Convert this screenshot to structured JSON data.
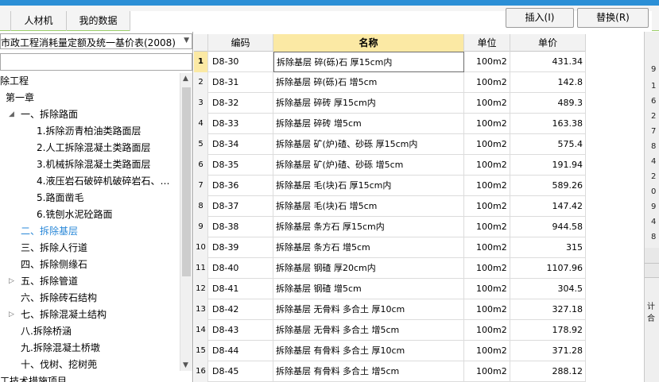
{
  "tabs": [
    {
      "label": "人材机"
    },
    {
      "label": "我的数据"
    }
  ],
  "toolbar": {
    "insert_label": "插入(I)",
    "replace_label": "替换(R)"
  },
  "left_panel": {
    "quota_select": "市政工程消耗量定额及统一基价表(2008)",
    "search_value": "",
    "tree": [
      {
        "label": "除工程"
      },
      {
        "label": "第一章"
      },
      {
        "label": "一、拆除路面"
      },
      {
        "label": "1.拆除沥青柏油类路面层"
      },
      {
        "label": "2.人工拆除混凝土类路面层"
      },
      {
        "label": "3.机械拆除混凝土类路面层"
      },
      {
        "label": "4.液压岩石破碎机破碎岩石、…"
      },
      {
        "label": "5.路面凿毛"
      },
      {
        "label": "6.铣刨水泥砼路面"
      },
      {
        "label": "二、拆除基层"
      },
      {
        "label": "三、拆除人行道"
      },
      {
        "label": "四、拆除侧缘石"
      },
      {
        "label": "五、拆除管道"
      },
      {
        "label": "六、拆除砖石结构"
      },
      {
        "label": "七、拆除混凝土结构"
      },
      {
        "label": "八.拆除桥涵"
      },
      {
        "label": "九.拆除混凝土桥墩"
      },
      {
        "label": "十、伐树、挖树蔸"
      },
      {
        "label": "工技术措施项目"
      }
    ]
  },
  "grid": {
    "columns": {
      "code": "编码",
      "name": "名称",
      "unit": "单位",
      "price": "单价"
    },
    "rows": [
      {
        "idx": "1",
        "code": "D8-30",
        "name": "拆除基层 碎(砾)石 厚15cm内",
        "unit": "100m2",
        "price": "431.34"
      },
      {
        "idx": "2",
        "code": "D8-31",
        "name": "拆除基层 碎(砾)石 增5cm",
        "unit": "100m2",
        "price": "142.8"
      },
      {
        "idx": "3",
        "code": "D8-32",
        "name": "拆除基层 碎砖 厚15cm内",
        "unit": "100m2",
        "price": "489.3"
      },
      {
        "idx": "4",
        "code": "D8-33",
        "name": "拆除基层 碎砖 增5cm",
        "unit": "100m2",
        "price": "163.38"
      },
      {
        "idx": "5",
        "code": "D8-34",
        "name": "拆除基层 矿(炉)碴、砂砾 厚15cm内",
        "unit": "100m2",
        "price": "575.4"
      },
      {
        "idx": "6",
        "code": "D8-35",
        "name": "拆除基层 矿(炉)碴、砂砾 增5cm",
        "unit": "100m2",
        "price": "191.94"
      },
      {
        "idx": "7",
        "code": "D8-36",
        "name": "拆除基层 毛(块)石 厚15cm内",
        "unit": "100m2",
        "price": "589.26"
      },
      {
        "idx": "8",
        "code": "D8-37",
        "name": "拆除基层 毛(块)石 增5cm",
        "unit": "100m2",
        "price": "147.42"
      },
      {
        "idx": "9",
        "code": "D8-38",
        "name": "拆除基层 条方石 厚15cm内",
        "unit": "100m2",
        "price": "944.58"
      },
      {
        "idx": "10",
        "code": "D8-39",
        "name": "拆除基层 条方石 增5cm",
        "unit": "100m2",
        "price": "315"
      },
      {
        "idx": "11",
        "code": "D8-40",
        "name": "拆除基层 钢碴 厚20cm内",
        "unit": "100m2",
        "price": "1107.96"
      },
      {
        "idx": "12",
        "code": "D8-41",
        "name": "拆除基层 钢碴 增5cm",
        "unit": "100m2",
        "price": "304.5"
      },
      {
        "idx": "13",
        "code": "D8-42",
        "name": "拆除基层 无骨料 多合土 厚10cm",
        "unit": "100m2",
        "price": "327.18"
      },
      {
        "idx": "14",
        "code": "D8-43",
        "name": "拆除基层 无骨料 多合土 增5cm",
        "unit": "100m2",
        "price": "178.92"
      },
      {
        "idx": "15",
        "code": "D8-44",
        "name": "拆除基层 有骨料 多合土 厚10cm",
        "unit": "100m2",
        "price": "371.28"
      },
      {
        "idx": "16",
        "code": "D8-45",
        "name": "拆除基层 有骨料 多合土 增5cm",
        "unit": "100m2",
        "price": "288.12"
      }
    ]
  },
  "right_strip": {
    "chars": [
      "9",
      "1",
      "6",
      "2",
      "7",
      "8",
      "4",
      "2",
      "0",
      "9",
      "4",
      "8"
    ],
    "bottom_label": "计合"
  }
}
